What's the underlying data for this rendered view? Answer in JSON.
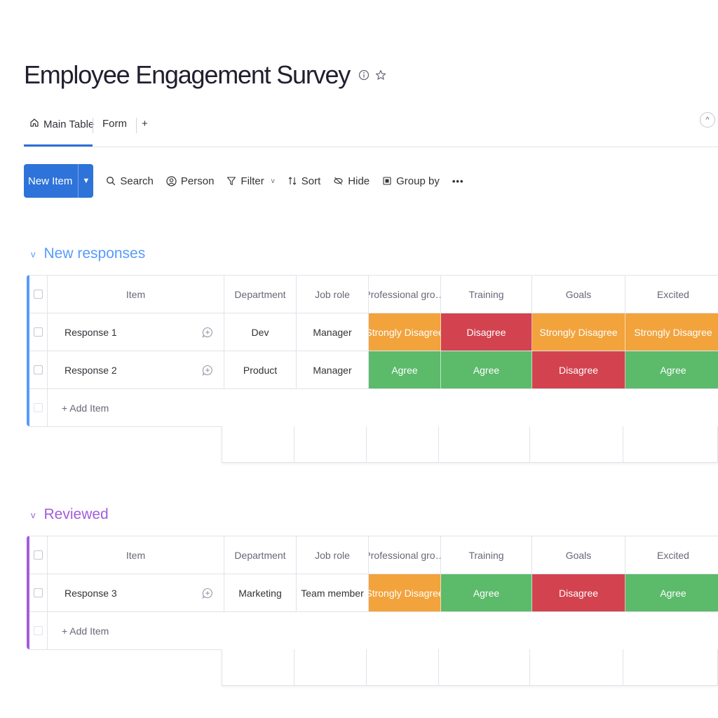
{
  "board": {
    "title": "Employee Engagement Survey",
    "info_icon": "info-icon",
    "star_icon": "star-icon"
  },
  "tabs": [
    {
      "label": "Main Table",
      "icon": "home-icon"
    },
    {
      "label": "Form"
    },
    {
      "label": "+"
    }
  ],
  "toolbar": {
    "new_item": "New Item",
    "search": "Search",
    "person": "Person",
    "filter": "Filter",
    "sort": "Sort",
    "hide": "Hide",
    "group_by": "Group by",
    "more": "•••"
  },
  "columns": [
    "Item",
    "Department",
    "Job role",
    "Professional gro…",
    "Training",
    "Goals",
    "Excited"
  ],
  "status_colors": {
    "Strongly Disagree": "#f2a33c",
    "Disagree": "#d2434f",
    "Agree": "#5cba6b"
  },
  "groups": [
    {
      "name": "New responses",
      "color": "#579bfc",
      "rows": [
        {
          "item": "Response 1",
          "department": "Dev",
          "job_role": "Manager",
          "statuses": [
            "Strongly Disagree",
            "Disagree",
            "Strongly Disagree",
            "Strongly Disagree"
          ]
        },
        {
          "item": "Response 2",
          "department": "Product",
          "job_role": "Manager",
          "statuses": [
            "Agree",
            "Agree",
            "Disagree",
            "Agree"
          ]
        }
      ],
      "add_item": "+ Add Item"
    },
    {
      "name": "Reviewed",
      "color": "#a25ddc",
      "rows": [
        {
          "item": "Response 3",
          "department": "Marketing",
          "job_role": "Team member",
          "statuses": [
            "Strongly Disagree",
            "Agree",
            "Disagree",
            "Agree"
          ]
        }
      ],
      "add_item": "+ Add Item"
    }
  ]
}
